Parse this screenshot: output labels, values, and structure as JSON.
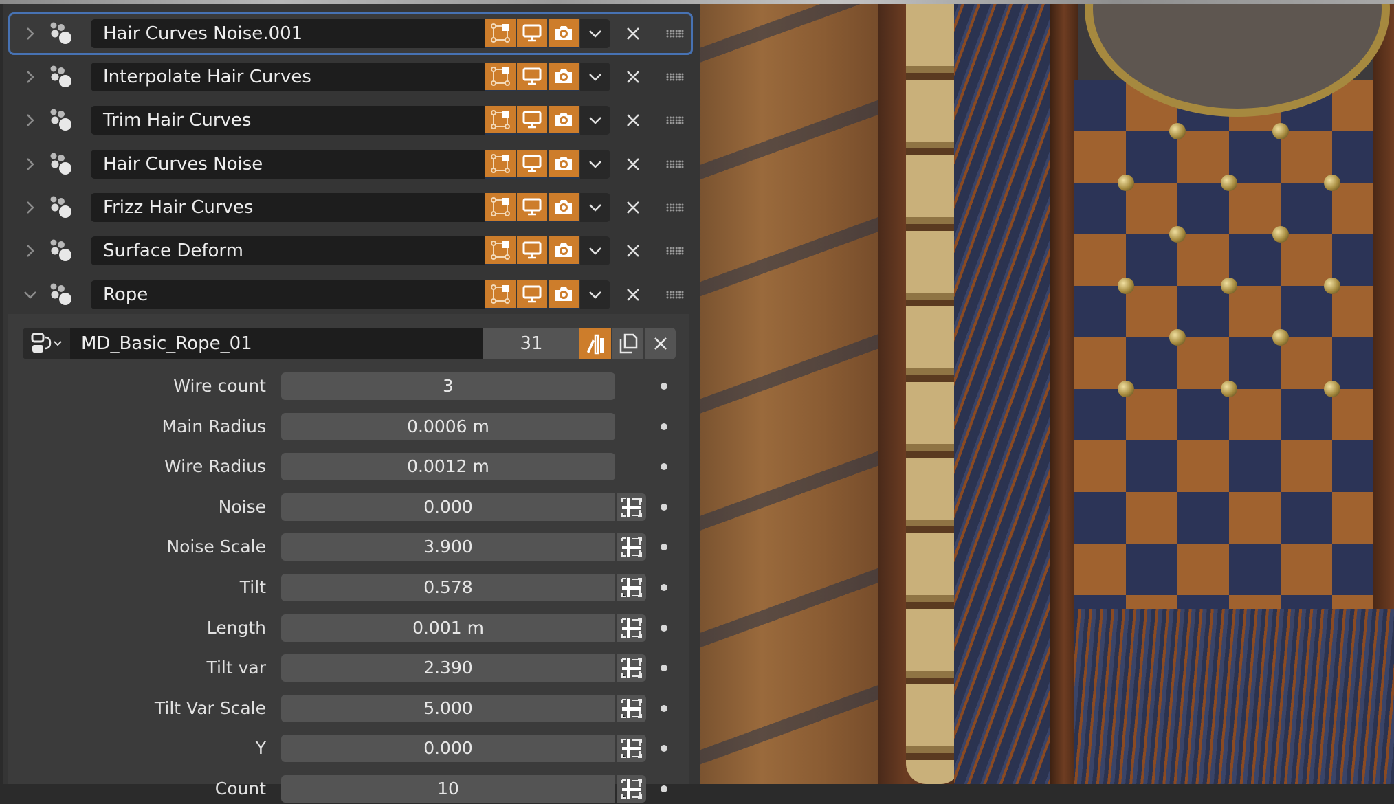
{
  "modifiers": [
    {
      "name": "Hair Curves Noise.001",
      "expanded": false,
      "active": true
    },
    {
      "name": "Interpolate Hair Curves",
      "expanded": false,
      "active": false
    },
    {
      "name": "Trim Hair Curves",
      "expanded": false,
      "active": false
    },
    {
      "name": "Hair Curves Noise",
      "expanded": false,
      "active": false
    },
    {
      "name": "Frizz Hair Curves",
      "expanded": false,
      "active": false
    },
    {
      "name": "Surface Deform",
      "expanded": false,
      "active": false
    },
    {
      "name": "Rope",
      "expanded": true,
      "active": false
    }
  ],
  "modifier_icons": {
    "type_icon": "geometry-nodes-icon",
    "edit_mode": "edit-mode-icon",
    "viewport": "viewport-display-icon",
    "render": "render-camera-icon",
    "dropdown": "chevron-down-icon",
    "remove": "close-icon",
    "grip": "drag-grip-icon"
  },
  "node_group": {
    "name": "MD_Basic_Rope_01",
    "users": "31",
    "fake_user_active": true
  },
  "parameters": [
    {
      "label": "Wire count",
      "value": "3",
      "socket": false
    },
    {
      "label": "Main Radius",
      "value": "0.0006 m",
      "socket": false
    },
    {
      "label": "Wire Radius",
      "value": "0.0012 m",
      "socket": false
    },
    {
      "label": "Noise",
      "value": "0.000",
      "socket": true
    },
    {
      "label": "Noise Scale",
      "value": "3.900",
      "socket": true
    },
    {
      "label": "Tilt",
      "value": "0.578",
      "socket": true
    },
    {
      "label": "Length",
      "value": "0.001 m",
      "socket": true
    },
    {
      "label": "Tilt var",
      "value": "2.390",
      "socket": true
    },
    {
      "label": "Tilt Var Scale",
      "value": "5.000",
      "socket": true
    },
    {
      "label": "Y",
      "value": "0.000",
      "socket": true
    },
    {
      "label": "Count",
      "value": "10",
      "socket": true
    }
  ],
  "colors": {
    "accent_orange": "#cd7d2b",
    "active_outline": "#4772b3",
    "panel_bg": "#353535",
    "field_bg": "#545454",
    "name_field_bg": "#1d1d1d"
  }
}
